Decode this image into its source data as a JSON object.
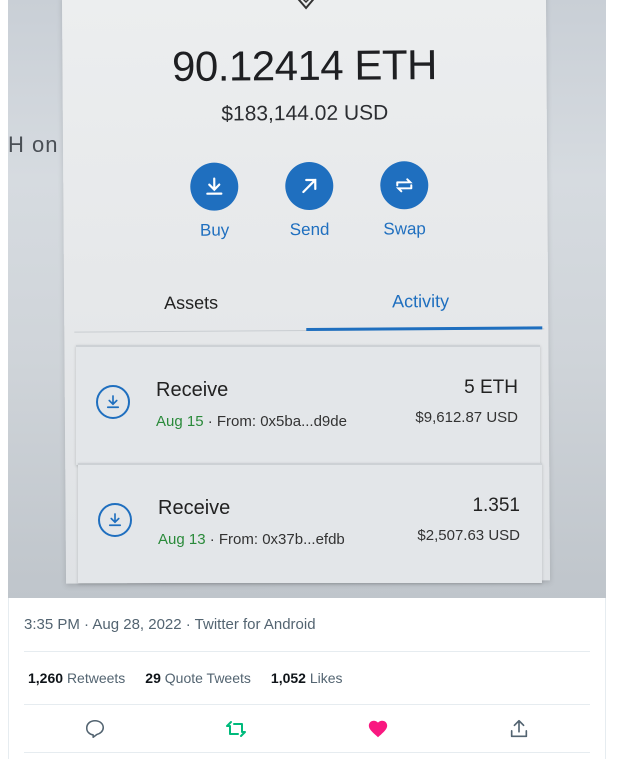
{
  "photo": {
    "side_text": "H on",
    "wallet": {
      "balance": "90.12414 ETH",
      "balance_usd": "$183,144.02 USD",
      "actions": [
        {
          "label": "Buy",
          "icon": "download-icon"
        },
        {
          "label": "Send",
          "icon": "arrow-up-right-icon"
        },
        {
          "label": "Swap",
          "icon": "swap-icon"
        }
      ],
      "tabs": [
        {
          "label": "Assets",
          "active": false
        },
        {
          "label": "Activity",
          "active": true
        }
      ],
      "transactions": [
        {
          "title": "Receive",
          "date": "Aug 15",
          "from": "· From: 0x5ba...d9de",
          "amount": "5 ETH",
          "amount_usd": "$9,612.87 USD"
        },
        {
          "title": "Receive",
          "date": "Aug 13",
          "from": "· From: 0x37b...efdb",
          "amount": "1.351",
          "amount_usd": "$2,507.63 USD"
        }
      ]
    }
  },
  "tweet_meta": "3:35 PM · Aug 28, 2022 · Twitter for Android",
  "stats": {
    "retweets_count": "1,260",
    "retweets_label": "Retweets",
    "quotes_count": "29",
    "quotes_label": "Quote Tweets",
    "likes_count": "1,052",
    "likes_label": "Likes"
  },
  "colors": {
    "accent": "#1f6fbf",
    "retweet": "#00ba7c",
    "like": "#f91880",
    "muted": "#536471"
  }
}
